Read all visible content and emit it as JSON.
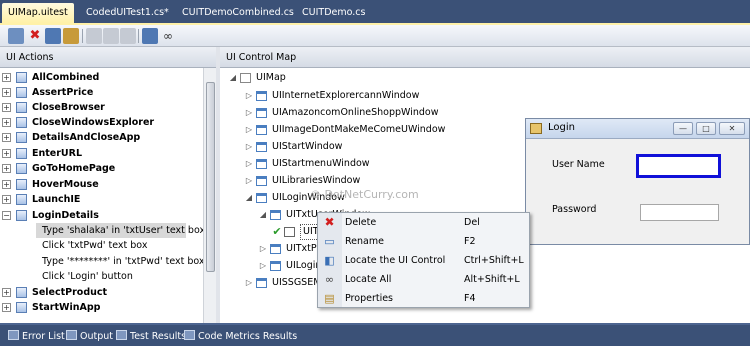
{
  "tabs": [
    {
      "label": "UIMap.uitest",
      "active": true
    },
    {
      "label": "CodedUITest1.cs*",
      "active": false
    },
    {
      "label": "CUITDemoCombined.cs",
      "active": false
    },
    {
      "label": "CUITDemo.cs",
      "active": false
    }
  ],
  "toolbar": {
    "buttons": [
      "add-icon",
      "delete-icon",
      "move-icon",
      "properties-icon",
      "split-icon",
      "copy-icon",
      "rename-icon",
      "locate-icon",
      "binoculars-icon"
    ]
  },
  "left_pane": {
    "title": "UI Actions",
    "actions": [
      {
        "label": "AllCombined",
        "expander": "+"
      },
      {
        "label": "AssertPrice",
        "expander": "+"
      },
      {
        "label": "CloseBrowser",
        "expander": "+"
      },
      {
        "label": "CloseWindowsExplorer",
        "expander": "+"
      },
      {
        "label": "DetailsAndCloseApp",
        "expander": "+"
      },
      {
        "label": "EnterURL",
        "expander": "+"
      },
      {
        "label": "GoToHomePage",
        "expander": "+"
      },
      {
        "label": "HoverMouse",
        "expander": "+"
      },
      {
        "label": "LaunchIE",
        "expander": "+"
      },
      {
        "label": "LoginDetails",
        "expander": "−"
      }
    ],
    "steps": [
      "Type 'shalaka' in 'txtUser' text box",
      "Click 'txtPwd' text box",
      "Type '********' in 'txtPwd' text box",
      "Click 'Login' button"
    ],
    "after_actions": [
      {
        "label": "SelectProduct",
        "expander": "+"
      },
      {
        "label": "StartWinApp",
        "expander": "+"
      }
    ]
  },
  "right_pane": {
    "title": "UI Control Map",
    "root": "UIMap",
    "nodes": [
      "UIInternetExplorercannWindow",
      "UIAmazoncomOnlineShoppWindow",
      "UIImageDontMakeMeComeUWindow",
      "UIStartWindow",
      "UIStartmenuWindow",
      "UILibrariesWindow",
      "UILoginWindow",
      "UITxtUserWindow",
      "UITx",
      "UITxtPv",
      "UILogin",
      "UISSGSEMS"
    ],
    "watermark": "© DotNetCurry.com"
  },
  "login_window": {
    "title": "Login",
    "user_label": "User Name",
    "password_label": "Password",
    "min": "—",
    "max": "□",
    "close": "✕"
  },
  "context_menu": [
    {
      "label": "Delete",
      "shortcut": "Del",
      "icon": "delete-icon",
      "glyph": "✖",
      "color": "#d21f1f"
    },
    {
      "label": "Rename",
      "shortcut": "F2",
      "icon": "rename-icon",
      "glyph": "▭",
      "color": "#3a6fb5"
    },
    {
      "label": "Locate the UI Control",
      "shortcut": "Ctrl+Shift+L",
      "icon": "locate-icon",
      "glyph": "◧",
      "color": "#3a6fb5"
    },
    {
      "label": "Locate All",
      "shortcut": "Alt+Shift+L",
      "icon": "binoculars-icon",
      "glyph": "∞",
      "color": "#444444"
    },
    {
      "label": "Properties",
      "shortcut": "F4",
      "icon": "properties-icon",
      "glyph": "▤",
      "color": "#b58a2a"
    }
  ],
  "bottom_tabs": [
    "Error List",
    "Output",
    "Test Results",
    "Code Metrics Results"
  ]
}
